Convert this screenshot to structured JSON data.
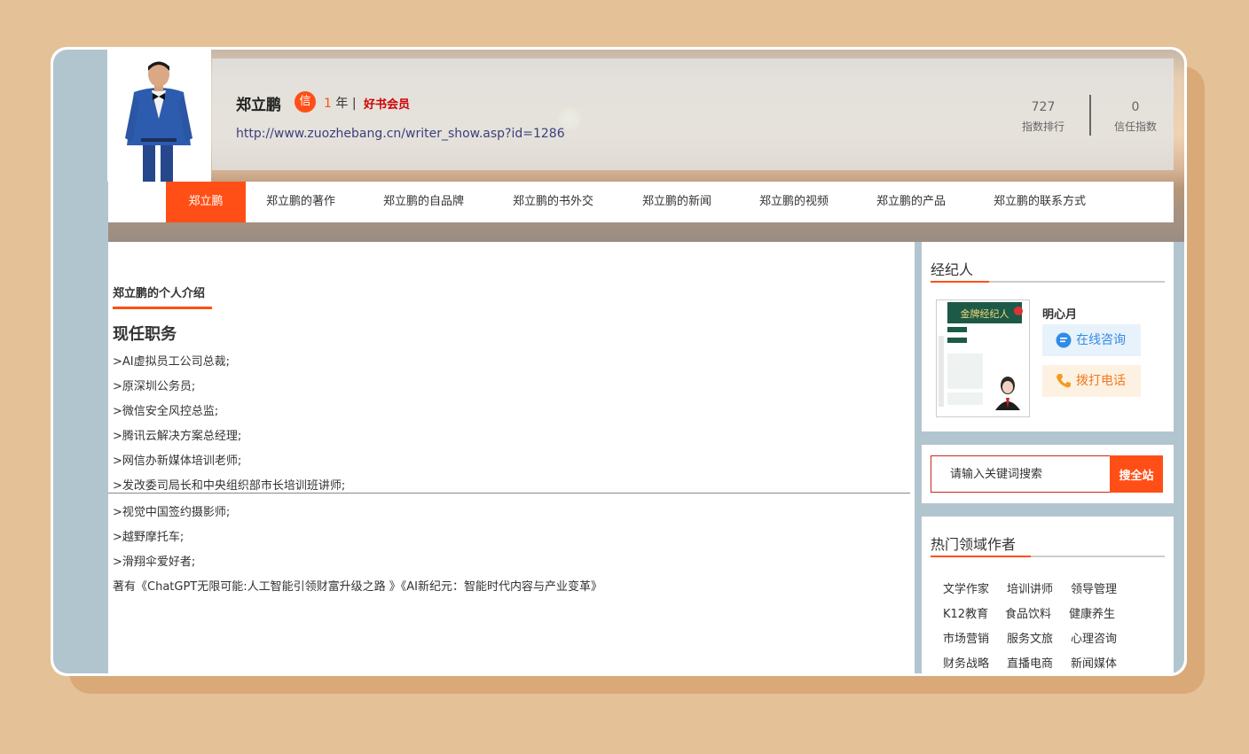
{
  "profile": {
    "name": "郑立鹏",
    "badge": "信",
    "years_num": "1",
    "years_unit": "年",
    "separator": "|",
    "member_level": "好书会员",
    "homepage_url": "http://www.zuozhebang.cn/writer_show.asp?id=1286"
  },
  "stats": [
    {
      "value": "727",
      "label": "指数排行"
    },
    {
      "value": "0",
      "label": "信任指数"
    }
  ],
  "nav": {
    "items": [
      "郑立鹏",
      "郑立鹏的著作",
      "郑立鹏的自品牌",
      "郑立鹏的书外交",
      "郑立鹏的新闻",
      "郑立鹏的视频",
      "郑立鹏的产品",
      "郑立鹏的联系方式"
    ],
    "active_index": 0
  },
  "main": {
    "intro_title": "郑立鹏的个人介绍",
    "section_heading": "现任职务",
    "duties": [
      ">AI虚拟员工公司总裁;",
      ">原深圳公务员;",
      ">微信安全风控总监;",
      ">腾讯云解决方案总经理;",
      ">网信办新媒体培训老师;",
      ">发改委司局长和中央组织部市长培训班讲师;",
      ">视觉中国签约摄影师;",
      ">越野摩托车;",
      ">滑翔伞爱好者;"
    ],
    "works_line": "著有《ChatGPT无限可能:人工智能引领财富升级之路 》《AI新纪元：智能时代内容与产业变革》"
  },
  "agent": {
    "section_title": "经纪人",
    "name": "明心月",
    "consult_label": "在线咨询",
    "call_label": "拨打电话",
    "poster_title": "金牌经纪人"
  },
  "search": {
    "placeholder": "请输入关键词搜索",
    "button_label": "搜全站"
  },
  "hot": {
    "section_title": "热门领域作者",
    "tags": [
      [
        "文学作家",
        "培训讲师",
        "领导管理"
      ],
      [
        "K12教育",
        "食品饮料",
        "健康养生"
      ],
      [
        "市场营销",
        "服务文旅",
        "心理咨询"
      ],
      [
        "财务战略",
        "直播电商",
        "新闻媒体"
      ]
    ]
  },
  "colors": {
    "accent": "#ff4f16",
    "page_bg": "#e5c197",
    "frame_bg": "#b1c5cf",
    "consult_blue": "#2f8ce6",
    "call_orange": "#f07a20"
  },
  "icons": [
    "chat-bubble-icon",
    "phone-icon"
  ]
}
